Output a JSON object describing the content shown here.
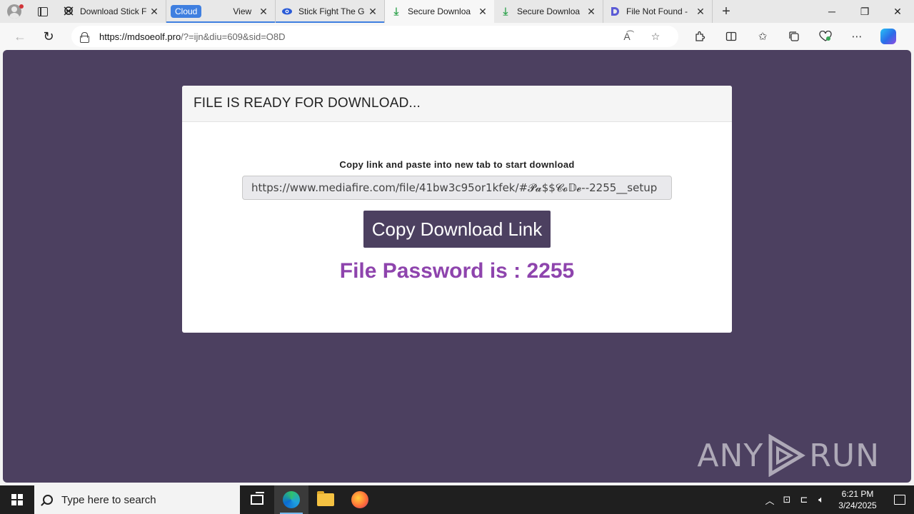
{
  "browser": {
    "tabs": [
      {
        "title": "Download Stick F",
        "close": "✕"
      },
      {
        "group_label": "Cloud",
        "title": "View",
        "close": "✕"
      },
      {
        "title": "Stick Fight The G",
        "close": "✕"
      },
      {
        "title": "Secure Downloa",
        "close": "✕"
      },
      {
        "title": "Secure Downloa",
        "close": "✕"
      },
      {
        "title": "File Not Found -",
        "close": "✕"
      }
    ],
    "new_tab": "+",
    "address": {
      "host": "https://mdsoeolf.pro",
      "path": "/?=ijn&diu=609&sid=O8D"
    }
  },
  "page": {
    "header": "FILE IS READY FOR DOWNLOAD...",
    "instruction": "Copy link and paste into new tab to start download",
    "link_value": "https://www.mediafire.com/file/41bw3c95or1kfek/#𝓟𝓪$$𝓒𝓸𝔻𝓮--2255__setup",
    "copy_button": "Copy Download Link",
    "password_text": "File Password is : 2255",
    "watermark_left": "ANY",
    "watermark_right": "RUN"
  },
  "taskbar": {
    "search_placeholder": "Type here to search",
    "time": "6:21 PM",
    "date": "3/24/2025"
  },
  "colors": {
    "page_background": "#4c4060",
    "button_background": "#4c4060",
    "password_color": "#8e44ad",
    "tab_group": "#3f7fe0"
  }
}
